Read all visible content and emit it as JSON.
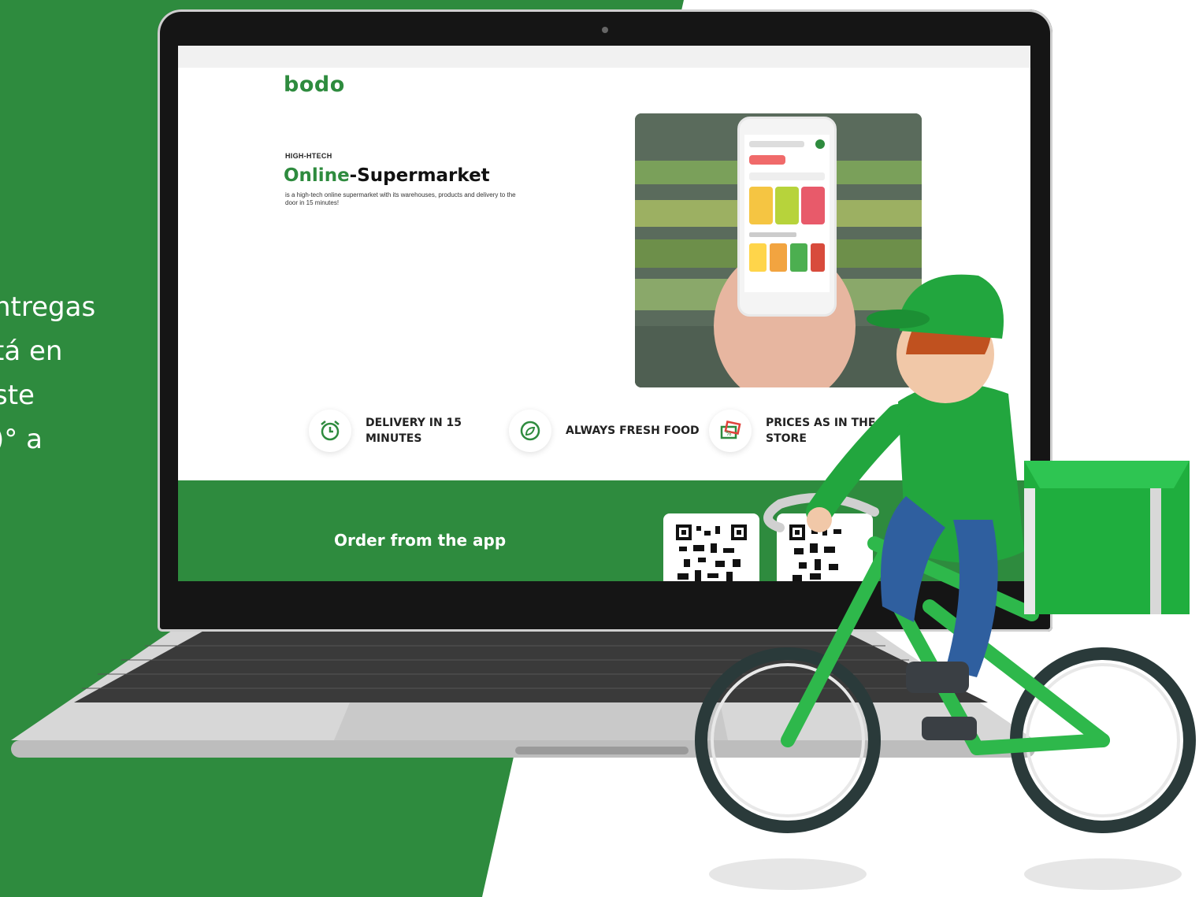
{
  "colors": {
    "brand_green": "#2e8b3e",
    "bg_green": "#2e8b3e",
    "white": "#ffffff"
  },
  "side_text": [
    "ntregas",
    "tá en",
    "ste",
    ")° a"
  ],
  "site": {
    "logo": "bodo",
    "kicker": "HIGH-HTECH",
    "headline_green": "Online",
    "headline_dash": "-",
    "headline_rest": "Supermarket",
    "description": "is a high-tech online supermarket with its warehouses, products and delivery to the door in 15 minutes!",
    "features": [
      {
        "icon": "alarm-clock-icon",
        "label_line1": "DELIVERY IN 15",
        "label_line2": "MINUTES"
      },
      {
        "icon": "fresh-leaf-icon",
        "label_line1": "ALWAYS FRESH FOOD",
        "label_line2": ""
      },
      {
        "icon": "price-tag-icon",
        "label_line1": "PRICES AS IN THE",
        "label_line2": "STORE"
      }
    ],
    "order_label": "Order from the app"
  },
  "illustration": {
    "subject": "delivery-courier-on-bicycle-icon"
  }
}
